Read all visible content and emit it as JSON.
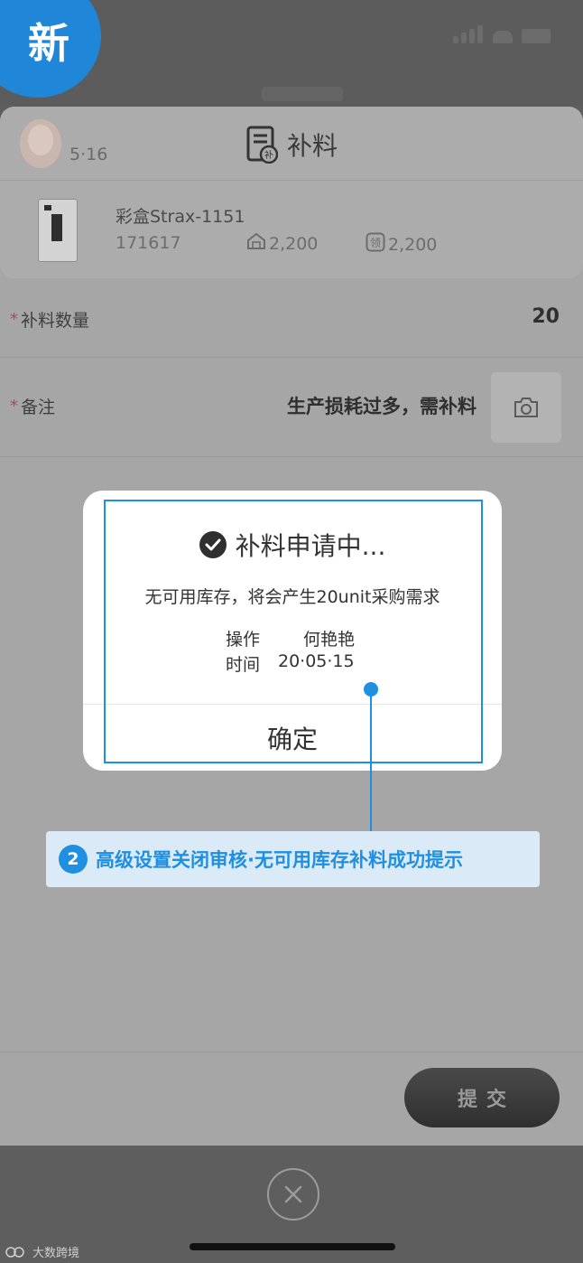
{
  "badge": {
    "label": "新",
    "color": "#1f86d8"
  },
  "header": {
    "date": "5·16",
    "title": "补料",
    "doc_icon_mark": "补"
  },
  "product": {
    "name": "彩盒Strax-1151",
    "code": "171617",
    "stock_warehouse": "2,200",
    "stock_claimed": "2,200",
    "claimed_icon_mark": "领"
  },
  "form": {
    "required_mark": "*",
    "qty_label": "补料数量",
    "qty_value": "20",
    "note_label": "备注",
    "note_value": "生产损耗过多，需补料"
  },
  "footer": {
    "submit_label": "提交"
  },
  "dialog": {
    "title": "补料申请中...",
    "message": "无可用库存，将会产生20unit采购需求",
    "operator_key": "操作",
    "operator_value": "何艳艳",
    "time_key": "时间",
    "time_value": "20·05·15",
    "ok_label": "确定"
  },
  "annotation": {
    "number": "2",
    "text": "高级设置关闭审核·无可用库存补料成功提示",
    "color": "#1e8fe3"
  },
  "watermark": {
    "text": "大数跨境"
  }
}
